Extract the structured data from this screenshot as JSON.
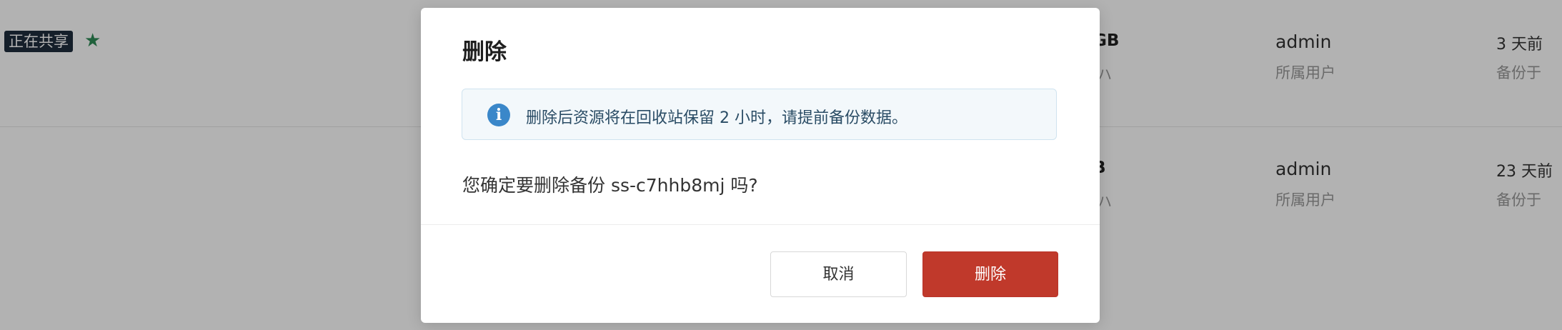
{
  "background": {
    "rows": [
      {
        "badge": "正在共享",
        "size": "GB",
        "size_sub": "ハ",
        "owner": "admin",
        "owner_label": "所属用户",
        "time": "3 天前",
        "time_label": "备份于"
      },
      {
        "size": "B",
        "size_sub": "ハ",
        "owner": "admin",
        "owner_label": "所属用户",
        "time": "23 天前",
        "time_label": "备份于"
      }
    ]
  },
  "dialog": {
    "title": "删除",
    "info_text": "删除后资源将在回收站保留 2 小时，请提前备份数据。",
    "confirm_text": "您确定要删除备份 ss-c7hhb8mj 吗?",
    "cancel_label": "取消",
    "delete_label": "删除"
  },
  "colors": {
    "accent_info": "#3a87c9",
    "danger": "#c0392b",
    "star": "#2e8b57",
    "badge_bg": "#1f2d3d"
  }
}
